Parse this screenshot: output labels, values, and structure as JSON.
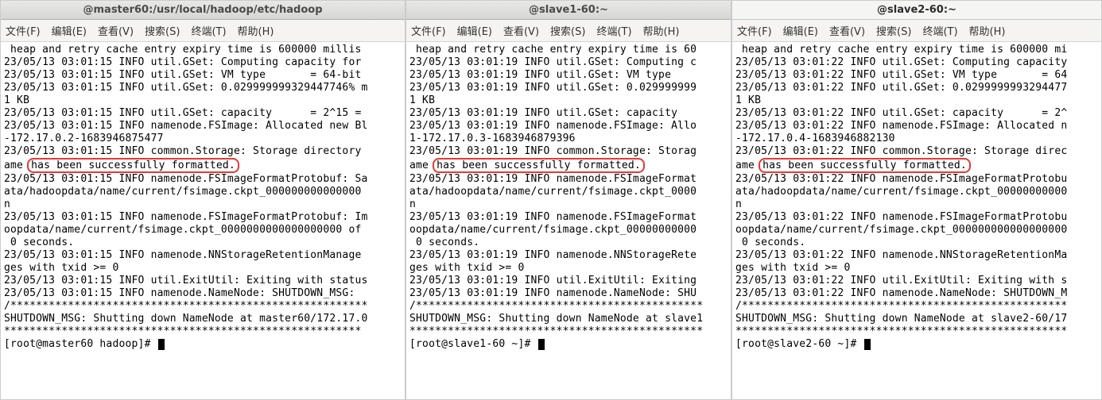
{
  "menus": {
    "file": "文件(F)",
    "edit": "编辑(E)",
    "view": "查看(V)",
    "search": "搜索(S)",
    "terminal": "终端(T)",
    "help": "帮助(H)"
  },
  "highlight_text": "has been successfully formatted.",
  "terminals": [
    {
      "title": "@master60:/usr/local/hadoop/etc/hadoop",
      "lines_before": [
        " heap and retry cache entry expiry time is 600000 millis",
        "23/05/13 03:01:15 INFO util.GSet: Computing capacity for",
        "23/05/13 03:01:15 INFO util.GSet: VM type       = 64-bit",
        "23/05/13 03:01:15 INFO util.GSet: 0.029999999329447746% m",
        "1 KB",
        "23/05/13 03:01:15 INFO util.GSet: capacity      = 2^15 = ",
        "23/05/13 03:01:15 INFO namenode.FSImage: Allocated new Bl",
        "-172.17.0.2-1683946875477",
        "23/05/13 03:01:15 INFO common.Storage: Storage directory "
      ],
      "highlight_prefix": "ame ",
      "lines_after": [
        "23/05/13 03:01:15 INFO namenode.FSImageFormatProtobuf: Sa",
        "ata/hadoopdata/name/current/fsimage.ckpt_000000000000000",
        "n",
        "23/05/13 03:01:15 INFO namenode.FSImageFormatProtobuf: Im",
        "oopdata/name/current/fsimage.ckpt_0000000000000000000 of",
        " 0 seconds.",
        "23/05/13 03:01:15 INFO namenode.NNStorageRetentionManage",
        "ges with txid >= 0",
        "23/05/13 03:01:15 INFO util.ExitUtil: Exiting with status",
        "23/05/13 03:01:15 INFO namenode.NameNode: SHUTDOWN_MSG:",
        "/********************************************************",
        "SHUTDOWN_MSG: Shutting down NameNode at master60/172.17.0",
        "********************************************************"
      ],
      "prompt": "[root@master60 hadoop]# "
    },
    {
      "title": "@slave1-60:~",
      "lines_before": [
        " heap and retry cache entry expiry time is 60",
        "23/05/13 03:01:19 INFO util.GSet: Computing c",
        "23/05/13 03:01:19 INFO util.GSet: VM type    ",
        "23/05/13 03:01:19 INFO util.GSet: 0.029999999",
        "1 KB",
        "23/05/13 03:01:19 INFO util.GSet: capacity   ",
        "23/05/13 03:01:19 INFO namenode.FSImage: Allo",
        "1-172.17.0.3-1683946879396",
        "23/05/13 03:01:19 INFO common.Storage: Storag"
      ],
      "highlight_prefix": "ame ",
      "lines_after": [
        "23/05/13 03:01:19 INFO namenode.FSImageFormat",
        "ata/hadoopdata/name/current/fsimage.ckpt_0000",
        "n",
        "23/05/13 03:01:19 INFO namenode.FSImageFormat",
        "oopdata/name/current/fsimage.ckpt_00000000000",
        " 0 seconds.",
        "23/05/13 03:01:19 INFO namenode.NNStorageRete",
        "ges with txid >= 0",
        "23/05/13 03:01:19 INFO util.ExitUtil: Exiting",
        "23/05/13 03:01:19 INFO namenode.NameNode: SHU",
        "/*********************************************",
        "SHUTDOWN_MSG: Shutting down NameNode at slave1",
        "**********************************************"
      ],
      "prompt": "[root@slave1-60 ~]# "
    },
    {
      "title": "@slave2-60:~",
      "lines_before": [
        " heap and retry cache entry expiry time is 600000 mi",
        "23/05/13 03:01:22 INFO util.GSet: Computing capacity",
        "23/05/13 03:01:22 INFO util.GSet: VM type       = 64",
        "23/05/13 03:01:22 INFO util.GSet: 0.0299999993294477",
        "1 KB",
        "23/05/13 03:01:22 INFO util.GSet: capacity      = 2^",
        "23/05/13 03:01:22 INFO namenode.FSImage: Allocated n",
        "-172.17.0.4-1683946882130",
        "23/05/13 03:01:22 INFO common.Storage: Storage direc"
      ],
      "highlight_prefix": "ame ",
      "lines_after": [
        "23/05/13 03:01:22 INFO namenode.FSImageFormatProtobu",
        "ata/hadoopdata/name/current/fsimage.ckpt_00000000000",
        "n",
        "23/05/13 03:01:22 INFO namenode.FSImageFormatProtobu",
        "oopdata/name/current/fsimage.ckpt_000000000000000000",
        " 0 seconds.",
        "23/05/13 03:01:22 INFO namenode.NNStorageRetentionMa",
        "ges with txid >= 0",
        "23/05/13 03:01:22 INFO util.ExitUtil: Exiting with s",
        "23/05/13 03:01:22 INFO namenode.NameNode: SHUTDOWN_M",
        "/***************************************************",
        "SHUTDOWN_MSG: Shutting down NameNode at slave2-60/17",
        "****************************************************"
      ],
      "prompt": "[root@slave2-60 ~]# "
    }
  ]
}
